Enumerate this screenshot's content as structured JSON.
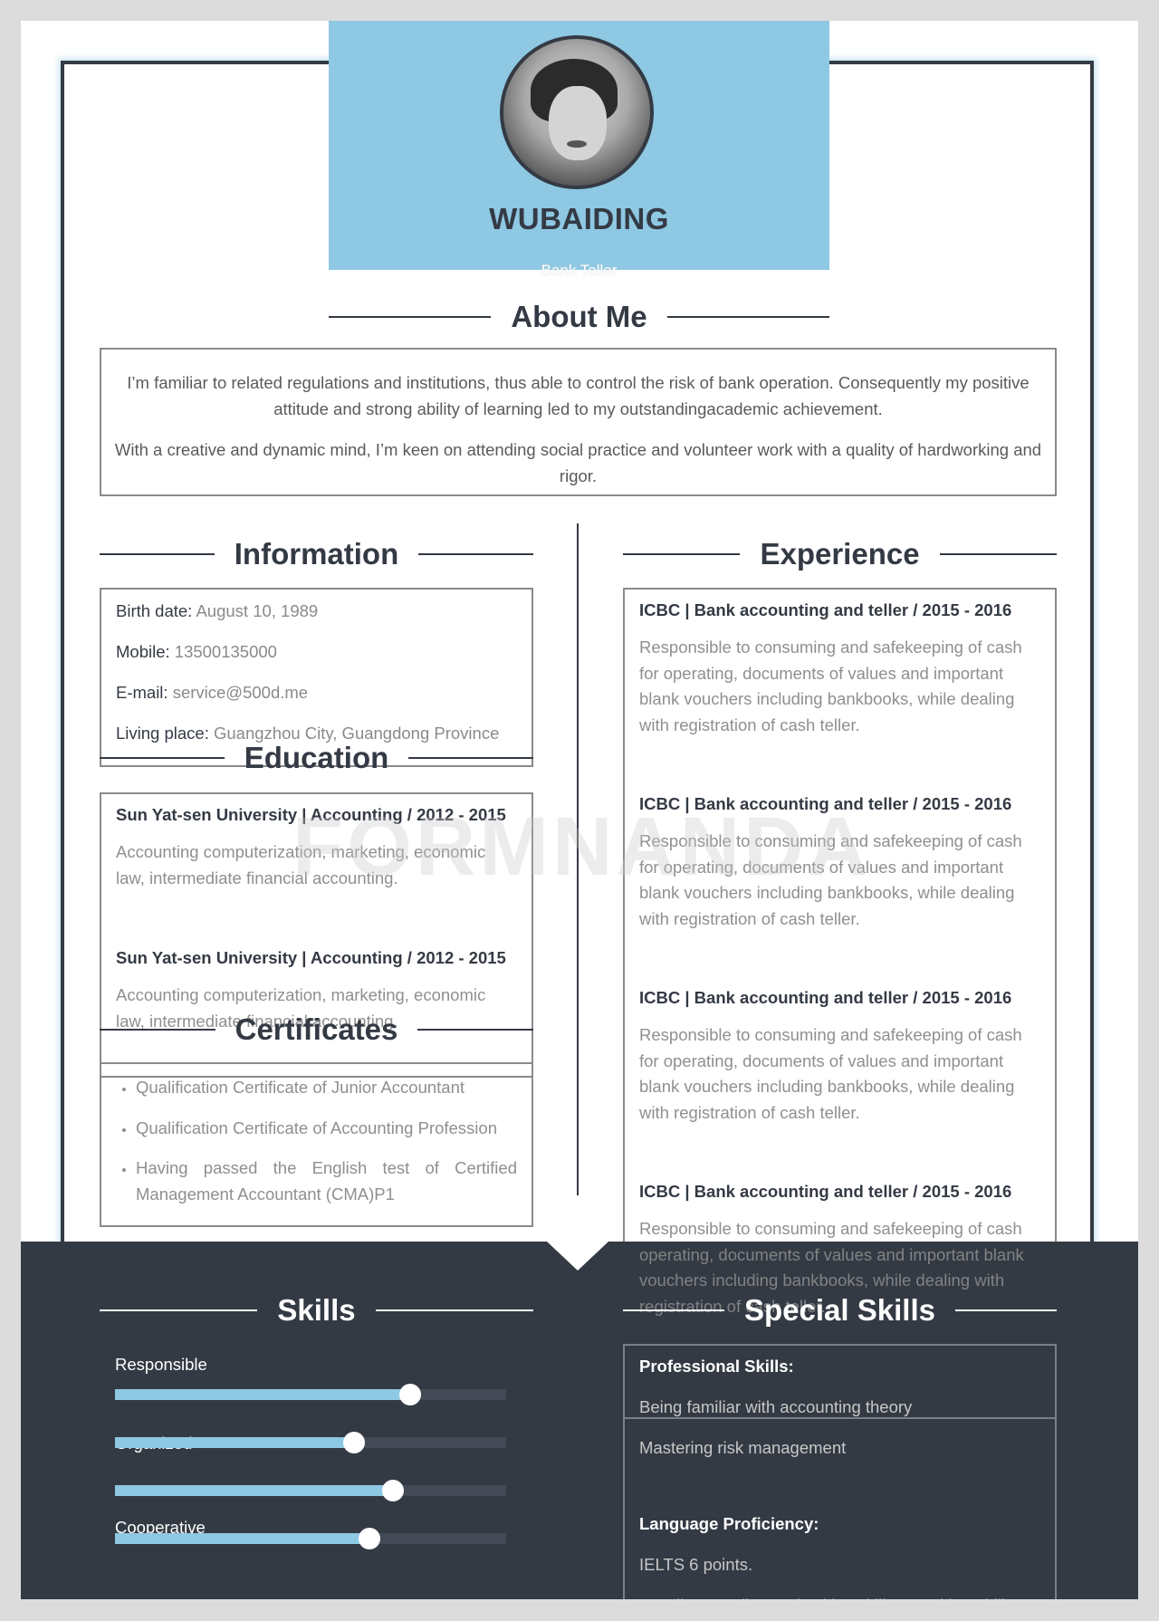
{
  "colors": {
    "accent": "#8ec8e3",
    "dark": "#343a44",
    "page_bg": "#dcdcdc"
  },
  "header": {
    "name": "WUBAIDING",
    "subtitle": "Bank Teller",
    "avatar_icon": "profile-photo"
  },
  "about": {
    "title": "About Me",
    "paragraphs": [
      "I’m familiar to related regulations and institutions, thus able to control the risk of bank operation. Consequently my positive attitude and strong ability of learning led to my outstandingacademic achievement.",
      "With a creative and dynamic mind, I’m keen on attending social practice and volunteer work with a quality of hardworking and rigor."
    ]
  },
  "information": {
    "title": "Information",
    "rows": [
      {
        "label": "Birth date:",
        "value": "August 10, 1989"
      },
      {
        "label": "Mobile:",
        "value": "13500135000"
      },
      {
        "label": "E-mail:",
        "value": "service@500d.me"
      },
      {
        "label": "Living place:",
        "value": "Guangzhou City, Guangdong Province"
      }
    ]
  },
  "education": {
    "title": "Education",
    "entries": [
      {
        "heading": "Sun Yat-sen University | Accounting / 2012 - 2015",
        "description": "Accounting computerization, marketing, economic law, intermediate financial accounting."
      },
      {
        "heading": "Sun Yat-sen University | Accounting / 2012 - 2015",
        "description": "Accounting computerization, marketing, economic law, intermediate financial accounting."
      }
    ]
  },
  "certificates": {
    "title": "Certificates",
    "items": [
      "Qualification Certificate of Junior Accountant",
      "Qualification Certificate of Accounting Profession",
      "Having passed the English test of Certified Management Accountant (CMA)P1"
    ]
  },
  "experience": {
    "title": "Experience",
    "entries": [
      {
        "heading": "ICBC | Bank accounting and teller / 2015 - 2016",
        "description": "Responsible to consuming and safekeeping of cash for operating, documents of values and important blank vouchers including bankbooks, while dealing with registration of cash teller."
      },
      {
        "heading": "ICBC | Bank accounting and teller / 2015 - 2016",
        "description": "Responsible to consuming and safekeeping of cash for operating, documents of values and important blank vouchers including bankbooks, while dealing with registration of cash teller."
      },
      {
        "heading": "ICBC | Bank accounting and teller / 2015 - 2016",
        "description": "Responsible to consuming and safekeeping of cash for operating, documents of values and important blank vouchers including bankbooks, while dealing with registration of cash teller."
      },
      {
        "heading": "ICBC | Bank accounting and teller / 2015 - 2016",
        "description": "Responsible to consuming and safekeeping of cash for operating, documents of values and important blank vouchers including bankbooks, while dealing with registration of cash teller."
      }
    ]
  },
  "skills": {
    "title": "Skills",
    "items": [
      {
        "label": "Responsible",
        "level": 0.755
      },
      {
        "label": "Organized",
        "level": 0.61
      },
      {
        "label": "",
        "level": 0.71
      },
      {
        "label": "Cooperative",
        "level": 0.65
      }
    ]
  },
  "special_skills": {
    "title": "Special Skills",
    "groups": [
      {
        "heading": "Professional Skills:",
        "items": [
          "Being familiar with accounting theory",
          "Mastering risk management"
        ]
      },
      {
        "heading": "Language Proficiency:",
        "items": [
          "IELTS 6 points.",
          "Excellent reading and writing skills, speaking ability ..."
        ]
      }
    ]
  },
  "watermark": "FORMNANDA"
}
